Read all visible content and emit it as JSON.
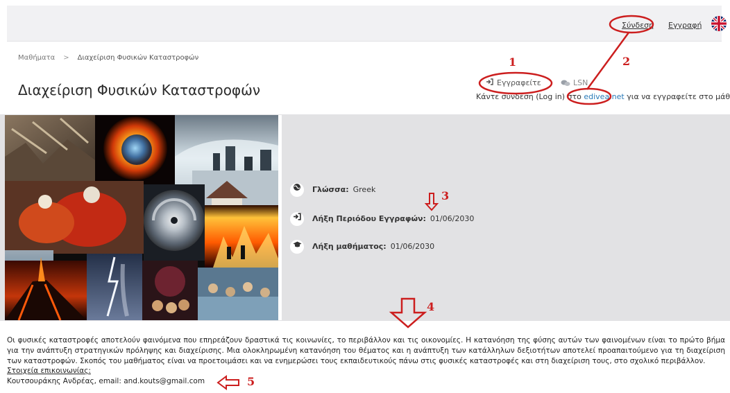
{
  "header": {
    "login_label": "Σύνδεση",
    "register_label": "Εγγραφή",
    "language_icon": "uk-flag-icon"
  },
  "breadcrumb": {
    "root": "Μαθήματα",
    "separator": ">",
    "current": "Διαχείριση Φυσικών Καταστροφών"
  },
  "course": {
    "title": "Διαχείριση Φυσικών Καταστροφών",
    "enroll_label": "Εγγραφείτε",
    "lsn_label": "LSN",
    "enroll_note_before": "Κάντε σύνδεση (Log in) στο",
    "enroll_note_link": "edivea.net",
    "enroll_note_after": "για να εγγραφείτε στο μάθημα."
  },
  "meta": {
    "language_label": "Γλώσσα:",
    "language_value": "Greek",
    "enroll_end_label": "Λήξη Περιόδου Εγγραφών:",
    "enroll_end_value": "01/06/2030",
    "course_end_label": "Λήξη μαθήματος:",
    "course_end_value": "01/06/2030"
  },
  "description": {
    "text": "Οι φυσικές καταστροφές αποτελούν φαινόμενα που επηρεάζουν δραστικά τις κοινωνίες, το περιβάλλον και τις οικονομίες. Η κατανόηση της φύσης αυτών των φαινομένων είναι το πρώτο βήμα για την ανάπτυξη στρατηγικών πρόληψης και διαχείρισης. Μια ολοκληρωμένη κατανόηση του θέματος και η ανάπτυξη των κατάλληλων δεξιοτήτων αποτελεί προαπαιτούμενο για τη διαχείριση των καταστροφών. Σκοπός του μαθήματος είναι να προετοιμάσει και να ενημερώσει τους εκπαιδευτικούς πάνω στις φυσικές καταστροφές και στη διαχείριση τους, στο σχολικό περιβάλλον.",
    "contacts_heading": "Στοιχεία επικοινωνίας:",
    "contacts_value": "Κουτσουράκης Ανδρέας, email: and.kouts@gmail.com"
  },
  "annotations": {
    "n1": "1",
    "n2": "2",
    "n3": "3",
    "n4": "4",
    "n5": "5",
    "color": "#cc1e1e"
  },
  "colors": {
    "topbar_bg": "#f1f1f3",
    "panel_bg": "#e2e2e4",
    "link": "#2a7ab8"
  }
}
